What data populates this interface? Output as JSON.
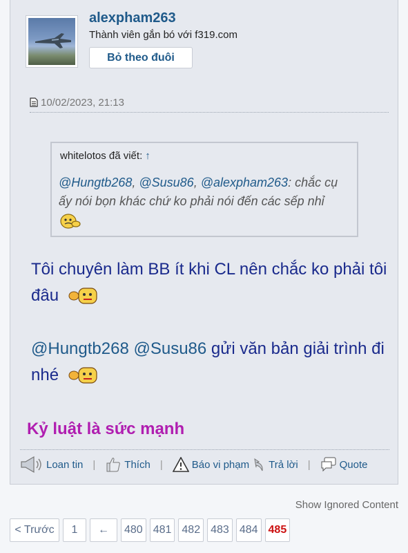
{
  "user": {
    "username": "alexpham263",
    "title": "Thành viên gắn bó với f319.com",
    "unfollow_label": "Bỏ theo đuôi"
  },
  "post": {
    "date": "10/02/2023, 21:13",
    "quote": {
      "author_line": "whitelotos đã viết:",
      "jump_icon": "↑",
      "mentions": [
        "@Hungtb268",
        "@Susu86",
        "@alexpham263"
      ],
      "sep1": ", ",
      "sep2": ", ",
      "text": ": chắc cụ ấy nói bọn khác chứ ko phải nói đến các sếp nhỉ"
    },
    "message1": "Tôi chuyên làm BB ít khi CL nên chắc ko phải tôi đâu",
    "message2": {
      "mention1": "@Hungtb268",
      "mention2": "@Susu86",
      "text": " gửi văn bản giải trình đi nhé"
    },
    "signature": "Kỷ luật là sức mạnh"
  },
  "actions": {
    "share": "Loan tin",
    "like": "Thích",
    "report": "Báo vi phạm",
    "reply": "Trả lời",
    "quote": "Quote",
    "separator": "|"
  },
  "show_ignored": "Show Ignored Content",
  "pagination": {
    "prev": "< Trước",
    "first": "1",
    "skip": "←",
    "pages": [
      "480",
      "481",
      "482",
      "483",
      "484",
      "485"
    ],
    "current": "485"
  }
}
